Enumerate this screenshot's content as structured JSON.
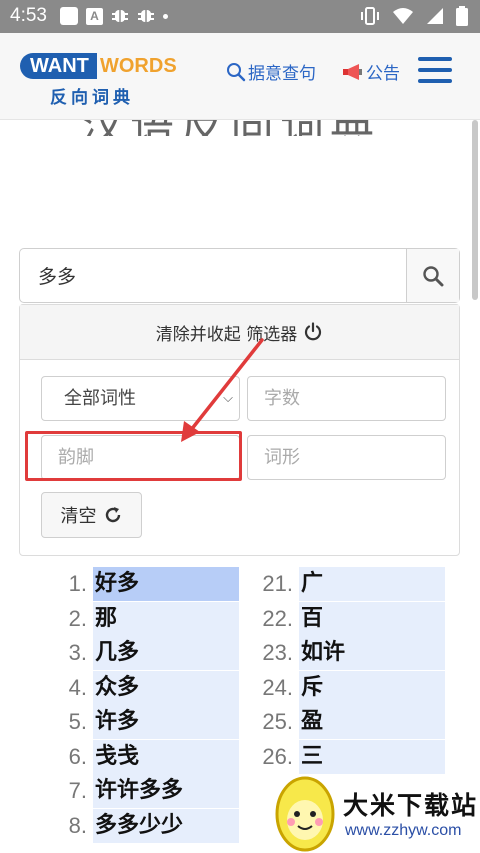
{
  "status_bar": {
    "time": "4:53",
    "left_icons": [
      "square-icon",
      "a-notification-icon",
      "bug-icon",
      "bug-icon",
      "dot-icon"
    ],
    "right_icons": [
      "vibrate-icon",
      "wifi-icon",
      "signal-icon",
      "battery-icon"
    ]
  },
  "header": {
    "logo_want": "WANT",
    "logo_words": "WORDS",
    "logo_sub": "反向词典",
    "nav_query": "据意查句",
    "nav_notice": "公告"
  },
  "title_partial": "汉语反向词典",
  "search": {
    "value": "多多",
    "placeholder": ""
  },
  "filter": {
    "header_label": "清除并收起 筛选器",
    "pos_select": "全部词性",
    "length_placeholder": "字数",
    "rhyme_placeholder": "韵脚",
    "shape_placeholder": "词形",
    "clear_label": "清空"
  },
  "colors": {
    "brand_blue": "#1f5fb0",
    "brand_orange": "#f0a22e",
    "link_blue": "#2b66c5",
    "highlight_red": "#e03b3b",
    "result_bg_strong": "#b7cdf7",
    "result_bg_light": "#e6eefc"
  },
  "results_left": [
    {
      "num": "1.",
      "word": "好多"
    },
    {
      "num": "2.",
      "word": "那"
    },
    {
      "num": "3.",
      "word": "几多"
    },
    {
      "num": "4.",
      "word": "众多"
    },
    {
      "num": "5.",
      "word": "许多"
    },
    {
      "num": "6.",
      "word": "戋戋"
    },
    {
      "num": "7.",
      "word": "许许多多"
    },
    {
      "num": "8.",
      "word": "多多少少"
    }
  ],
  "results_right": [
    {
      "num": "21.",
      "word": "广"
    },
    {
      "num": "22.",
      "word": "百"
    },
    {
      "num": "23.",
      "word": "如许"
    },
    {
      "num": "24.",
      "word": "斥"
    },
    {
      "num": "25.",
      "word": "盈"
    },
    {
      "num": "26.",
      "word": "三"
    }
  ],
  "watermark": {
    "text": "大米下载站",
    "url": "www.zzhyw.com"
  }
}
